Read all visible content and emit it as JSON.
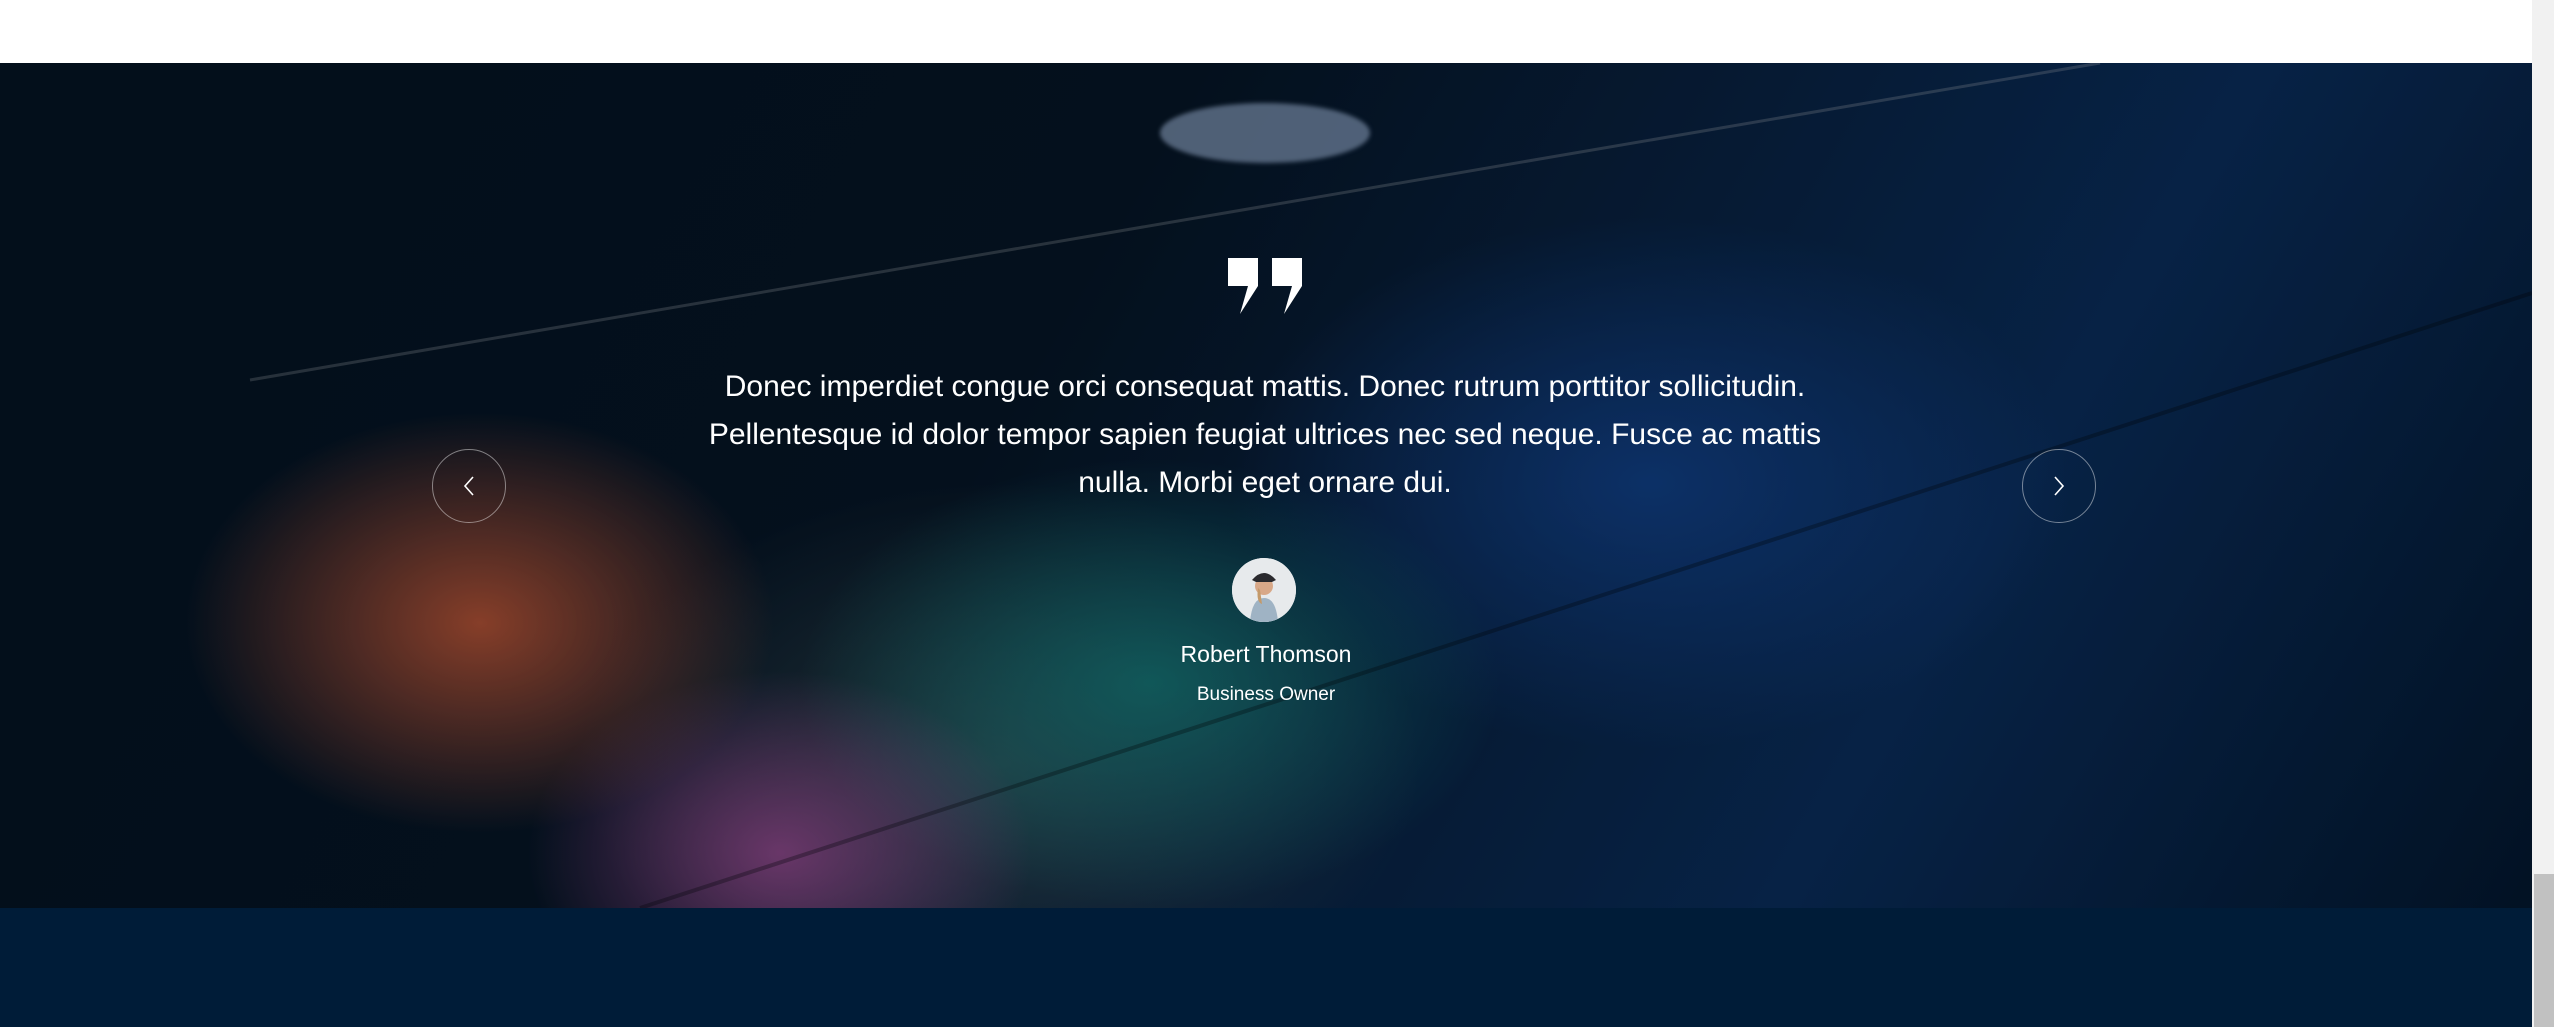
{
  "testimonial": {
    "quote_icon": "quote-icon",
    "text": "Donec imperdiet congue orci consequat mattis. Donec rutrum porttitor sollicitudin. Pellentesque id dolor tempor sapien feugiat ultrices nec sed neque. Fusce ac mattis nulla. Morbi eget ornare dui.",
    "author_name": "Robert Thomson",
    "author_role": "Business Owner",
    "prev_icon": "chevron-left-icon",
    "next_icon": "chevron-right-icon"
  },
  "colors": {
    "footer_bg": "#001c38",
    "text": "#ffffff"
  }
}
